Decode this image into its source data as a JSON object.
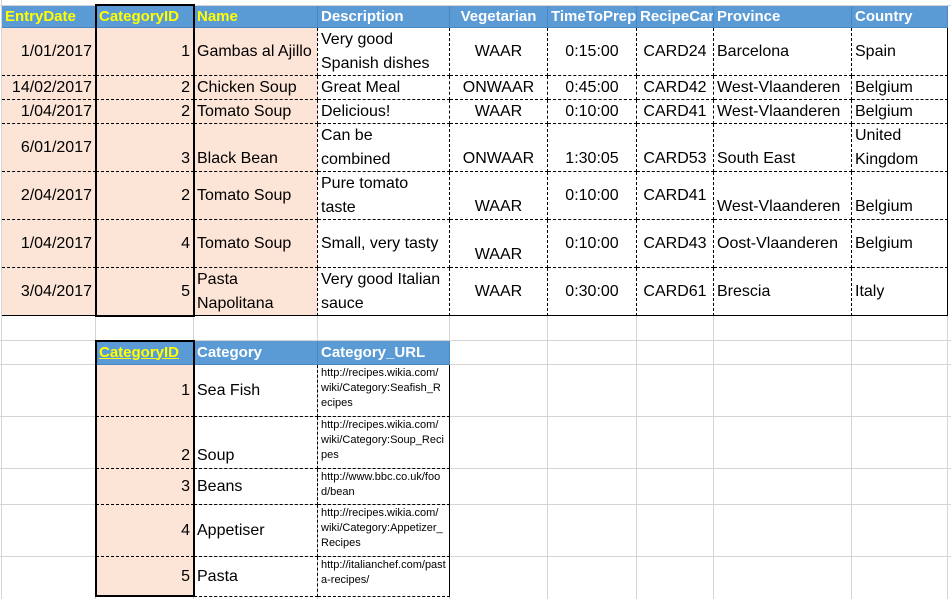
{
  "recipes": {
    "headers": [
      "EntryDate",
      "CategoryID",
      "Name",
      "Description",
      "Vegetarian",
      "TimeToPrep",
      "RecipeCard",
      "Province",
      "Country"
    ],
    "rows": [
      [
        "1/01/2017",
        "1",
        "Gambas al Ajillo",
        "Very good\nSpanish dishes",
        "WAAR",
        "0:15:00",
        "CARD24",
        "Barcelona",
        "Spain"
      ],
      [
        "14/02/2017",
        "2",
        "Chicken Soup",
        "Great Meal",
        "ONWAAR",
        "0:45:00",
        "CARD42",
        "West-Vlaanderen",
        " Belgium"
      ],
      [
        "1/04/2017",
        "2",
        "Tomato Soup",
        "Delicious!",
        "WAAR",
        "0:10:00",
        "CARD41",
        "West-Vlaanderen",
        " Belgium"
      ],
      [
        "6/01/2017",
        "3",
        "Black Bean",
        "Can be combined",
        "ONWAAR",
        "1:30:05",
        "CARD53",
        "South East",
        "United\nKingdom"
      ],
      [
        "2/04/2017",
        "2",
        "Tomato Soup",
        "Pure tomato\ntaste",
        "WAAR",
        "0:10:00",
        "CARD41",
        "West-Vlaanderen",
        " Belgium"
      ],
      [
        "1/04/2017",
        "4",
        "Tomato Soup",
        "Small, very tasty",
        "WAAR",
        "0:10:00",
        "CARD43",
        "Oost-Vlaanderen",
        " Belgium"
      ],
      [
        "3/04/2017",
        "5",
        "Pasta\nNapolitana",
        "Very good Italian\nsauce",
        "WAAR",
        "0:30:00",
        "CARD61",
        "Brescia",
        " Italy"
      ]
    ]
  },
  "categories": {
    "headers": [
      "CategoryID",
      "Category",
      "Category_URL"
    ],
    "rows": [
      [
        "1",
        "Sea Fish",
        "http://recipes.wikia.com/wiki/Category:Seafish_Recipes"
      ],
      [
        "2",
        "Soup",
        "http://recipes.wikia.com/wiki/Category:Soup_Recipes"
      ],
      [
        "3",
        "Beans",
        "http://www.bbc.co.uk/food/bean"
      ],
      [
        "4",
        "Appetiser",
        "http://recipes.wikia.com/wiki/Category:Appetizer_Recipes"
      ],
      [
        "5",
        "Pasta",
        "http://italianchef.com/pasta-recipes/"
      ]
    ]
  }
}
